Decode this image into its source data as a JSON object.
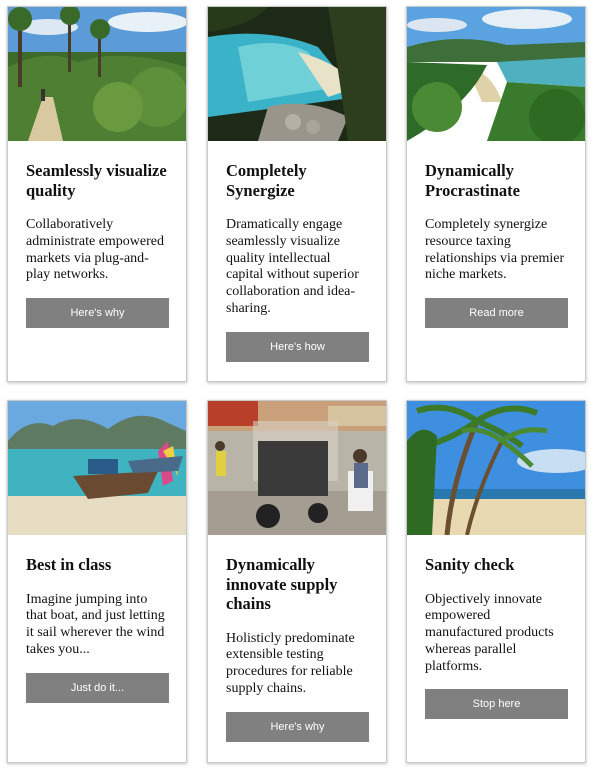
{
  "cards": [
    {
      "title": "Seamlessly visualize quality",
      "text": "Collaboratively administrate empowered markets via plug-and-play networks.",
      "button": "Here's why",
      "image": "forest-trail-photo"
    },
    {
      "title": "Completely Synergize",
      "text": "Dramatically engage seamlessly visualize quality intellectual capital without superior collaboration and idea-sharing.",
      "button": "Here's how",
      "image": "rocky-cove-photo"
    },
    {
      "title": "Dynamically Procrastinate",
      "text": "Completely synergize resource taxing relationships via premier niche markets.",
      "button": "Read more",
      "image": "green-bay-photo"
    },
    {
      "title": "Best in class",
      "text": "Imagine jumping into that boat, and just letting it sail wherever the wind takes you...",
      "button": "Just do it...",
      "image": "longtail-boat-photo"
    },
    {
      "title": "Dynamically innovate supply chains",
      "text": "Holisticly predominate extensible testing procedures for reliable supply chains.",
      "button": "Here's why",
      "image": "street-tuk-tuk-photo"
    },
    {
      "title": "Sanity check",
      "text": "Objectively innovate empowered manufactured products whereas parallel platforms.",
      "button": "Stop here",
      "image": "palm-beach-photo"
    }
  ]
}
